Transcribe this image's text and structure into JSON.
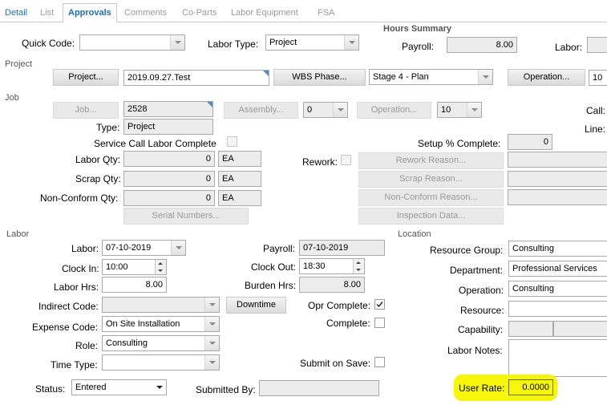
{
  "tabs": [
    "Detail",
    "List",
    "Approvals",
    "Comments",
    "Co-Parts",
    "Labor Equipment",
    "FSA"
  ],
  "hours_summary": {
    "title": "Hours Summary",
    "payroll_label": "Payroll:",
    "payroll_value": "8.00",
    "labor_label": "Labor:"
  },
  "top": {
    "quick_code_label": "Quick Code:",
    "labor_type_label": "Labor Type:",
    "labor_type_value": "Project"
  },
  "sections": {
    "project": "Project",
    "job": "Job",
    "labor": "Labor",
    "location": "Location"
  },
  "project": {
    "project_button": "Project...",
    "project_value": "2019.09.27.Test",
    "wbs_button": "WBS Phase...",
    "wbs_value": "Stage 4 - Plan",
    "operation_button": "Operation...",
    "operation_value": "10"
  },
  "job": {
    "job_button": "Job...",
    "job_value": "2528",
    "assembly_button": "Assembly...",
    "assembly_value": "0",
    "operation_button": "Operation...",
    "operation_value": "10",
    "call_label": "Call:",
    "line_label": "Line:",
    "type_label": "Type:",
    "type_value": "Project",
    "service_call_label": "Service Call Labor Complete",
    "setup_label": "Setup % Complete:",
    "setup_value": "0",
    "labor_qty_label": "Labor Qty:",
    "labor_qty_value": "0",
    "labor_qty_uom": "EA",
    "scrap_qty_label": "Scrap Qty:",
    "scrap_qty_value": "0",
    "scrap_qty_uom": "EA",
    "nonconform_qty_label": "Non-Conform Qty:",
    "nonconform_qty_value": "0",
    "nonconform_qty_uom": "EA",
    "rework_label": "Rework:",
    "rework_reason_button": "Rework Reason...",
    "scrap_reason_button": "Scrap Reason...",
    "nonconform_reason_button": "Non-Conform Reason...",
    "serial_numbers_button": "Serial Numbers...",
    "inspection_data_button": "Inspection Data..."
  },
  "labor": {
    "labor_label": "Labor:",
    "labor_date": "07-10-2019",
    "payroll_label": "Payroll:",
    "payroll_date": "07-10-2019",
    "clock_in_label": "Clock In:",
    "clock_in_value": "10:00",
    "clock_out_label": "Clock Out:",
    "clock_out_value": "18:30",
    "labor_hrs_label": "Labor Hrs:",
    "labor_hrs_value": "8.00",
    "burden_hrs_label": "Burden Hrs:",
    "burden_hrs_value": "8.00",
    "indirect_code_label": "Indirect Code:",
    "downtime_button": "Downtime",
    "opr_complete_label": "Opr Complete:",
    "complete_label": "Complete:",
    "expense_code_label": "Expense Code:",
    "expense_code_value": "On Site Installation",
    "role_label": "Role:",
    "role_value": "Consulting",
    "time_type_label": "Time Type:",
    "submit_on_save_label": "Submit on Save:",
    "status_label": "Status:",
    "status_value": "Entered",
    "submitted_by_label": "Submitted By:"
  },
  "location": {
    "resource_group_label": "Resource Group:",
    "resource_group_value": "Consulting",
    "department_label": "Department:",
    "department_value": "Professional Services",
    "operation_label": "Operation:",
    "operation_value": "Consulting",
    "resource_label": "Resource:",
    "capability_label": "Capability:",
    "labor_notes_label": "Labor Notes:",
    "user_rate_label": "User Rate:",
    "user_rate_value": "0.0000"
  }
}
